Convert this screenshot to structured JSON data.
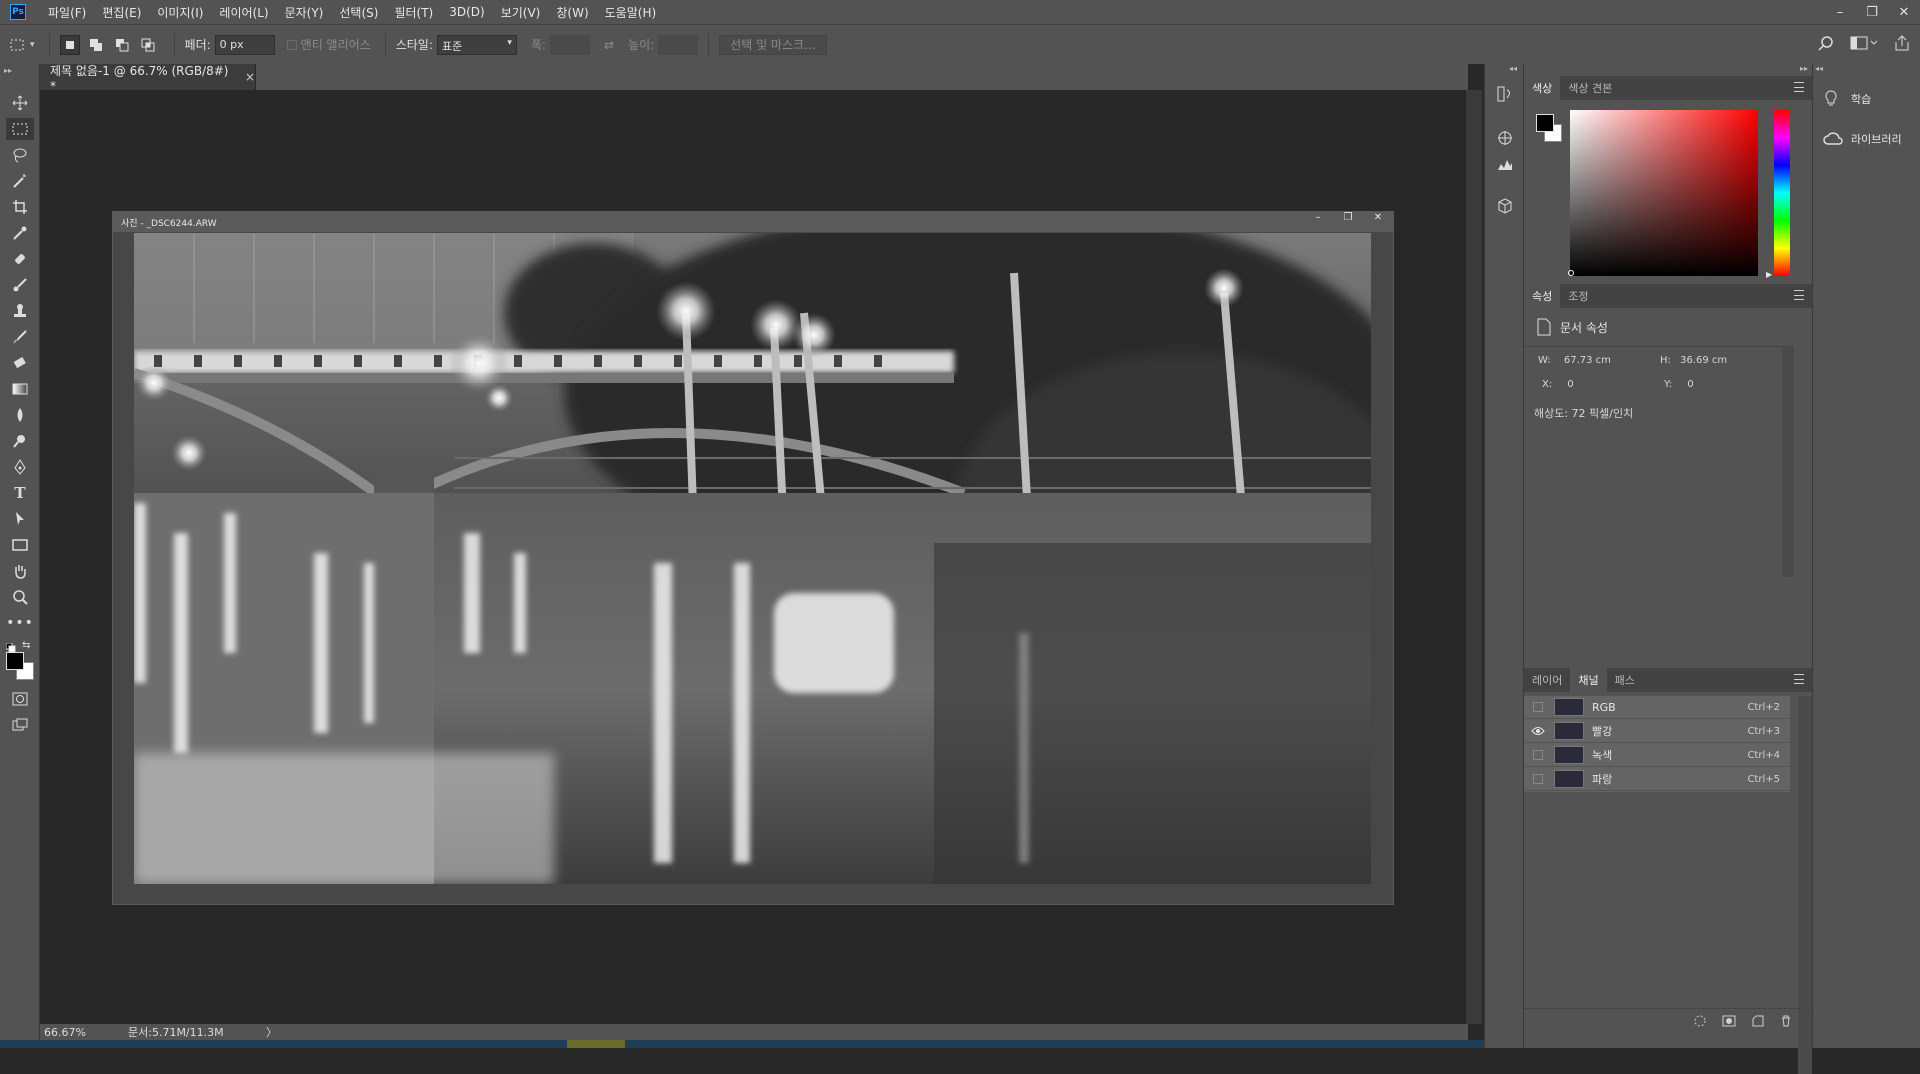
{
  "menubar": {
    "logo": "Ps",
    "items": [
      "파일(F)",
      "편집(E)",
      "이미지(I)",
      "레이어(L)",
      "문자(Y)",
      "선택(S)",
      "필터(T)",
      "3D(D)",
      "보기(V)",
      "창(W)",
      "도움말(H)"
    ],
    "window_buttons": [
      "–",
      "❐",
      "✕"
    ]
  },
  "options": {
    "feather_label": "페더:",
    "feather_value": "0 px",
    "antialias_label": "앤티 앨리어스",
    "style_label": "스타일:",
    "style_value": "표준",
    "width_label": "폭:",
    "height_label": "높이:",
    "select_mask_label": "선택 및 마스크..."
  },
  "document": {
    "tab_title": "제목 없음-1 @ 66.7% (RGB/8#) *",
    "tab_close": "×",
    "window_title": "사진 - _DSC6244.ARW",
    "window_buttons": [
      "–",
      "❐",
      "✕"
    ]
  },
  "status": {
    "zoom": "66.67%",
    "doc_info": "문서:5.71M/11.3M",
    "arrow": "〉"
  },
  "color_panel": {
    "tabs": [
      "색상",
      "색상 견본"
    ],
    "active_tab": "색상",
    "foreground": "#000000",
    "background": "#ffffff"
  },
  "properties_panel": {
    "tabs": [
      "속성",
      "조정"
    ],
    "active_tab": "속성",
    "heading": "문서 속성",
    "w_label": "W:",
    "w_value": "67.73 cm",
    "h_label": "H:",
    "h_value": "36.69 cm",
    "x_label": "X:",
    "x_value": "0",
    "y_label": "Y:",
    "y_value": "0",
    "resolution": "해상도: 72 픽셀/인치"
  },
  "channels_panel": {
    "tabs": [
      "레이어",
      "채널",
      "패스"
    ],
    "active_tab": "채널",
    "channels": [
      {
        "name": "RGB",
        "shortcut": "Ctrl+2",
        "visible": false
      },
      {
        "name": "빨강",
        "shortcut": "Ctrl+3",
        "visible": true
      },
      {
        "name": "녹색",
        "shortcut": "Ctrl+4",
        "visible": false
      },
      {
        "name": "파랑",
        "shortcut": "Ctrl+5",
        "visible": false
      }
    ]
  },
  "learn_panel": {
    "learn_label": "학습",
    "library_label": "라이브러리"
  },
  "colors": {
    "chrome": "#535353",
    "canvas": "#282828",
    "accent": "#31a8ff"
  }
}
